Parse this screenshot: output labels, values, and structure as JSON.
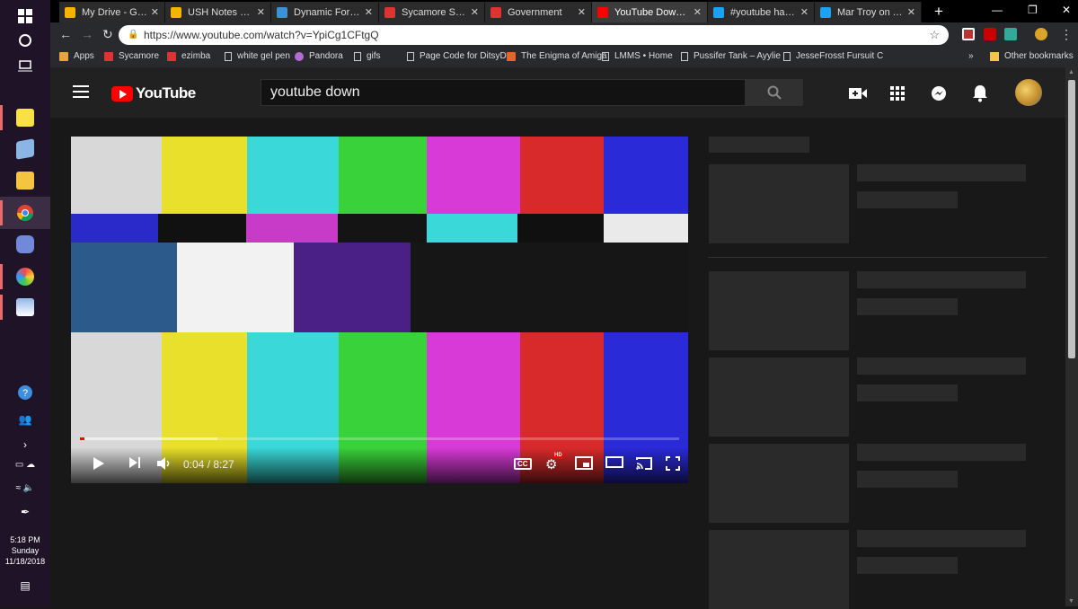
{
  "taskbar": {
    "clock_time": "5:18 PM",
    "clock_day": "Sunday",
    "clock_date": "11/18/2018"
  },
  "tabs": [
    {
      "title": "My Drive - Google",
      "icon": "google-drive-icon",
      "color": "#f4b400"
    },
    {
      "title": "USH Notes Project",
      "icon": "google-docs-icon",
      "color": "#f4b400"
    },
    {
      "title": "Dynamic Forms - a",
      "icon": "dynamic-forms-icon",
      "color": "#3d8fd6"
    },
    {
      "title": "Sycamore School",
      "icon": "sycamore-icon",
      "color": "#d33"
    },
    {
      "title": "Government",
      "icon": "sycamore-icon",
      "color": "#d33"
    },
    {
      "title": "YouTube Down... T",
      "icon": "youtube-icon",
      "color": "#f00",
      "active": true
    },
    {
      "title": "#youtube hashtag",
      "icon": "twitter-icon",
      "color": "#1da1f2"
    },
    {
      "title": "Mar Troy on Twitte",
      "icon": "twitter-icon",
      "color": "#1da1f2"
    }
  ],
  "url": "https://www.youtube.com/watch?v=YpiCg1CFtgQ",
  "bookmarks": [
    {
      "label": "Apps",
      "icon": "apps-grid-icon"
    },
    {
      "label": "Sycamore",
      "icon": "sycamore-icon"
    },
    {
      "label": "ezimba",
      "icon": "ezimba-icon"
    },
    {
      "label": "white gel pen",
      "icon": "page-icon"
    },
    {
      "label": "Pandora",
      "icon": "pandora-icon"
    },
    {
      "label": "gifs",
      "icon": "page-icon"
    },
    {
      "label": "Page Code for DitsyD",
      "icon": "page-icon"
    },
    {
      "label": "The Enigma of Amiga",
      "icon": "etsy-icon"
    },
    {
      "label": "LMMS • Home",
      "icon": "page-icon"
    },
    {
      "label": "Pussifer Tank – Ayylie",
      "icon": "page-icon"
    },
    {
      "label": "JesseFrosst Fursuit C",
      "icon": "page-icon"
    }
  ],
  "bookmarks_overflow": "»",
  "other_bookmarks": "Other bookmarks",
  "youtube": {
    "logo_text": "YouTube",
    "search_value": "youtube down",
    "player": {
      "current_time": "0:04",
      "separator": " / ",
      "duration": "8:27",
      "progress_fraction": 0.008,
      "buffered_fraction": 0.23,
      "cc_label": "CC",
      "hd_badge": "HD"
    }
  },
  "colors": {
    "youtube_red": "#ff0000",
    "taskbar_bg": "#1e1327"
  }
}
